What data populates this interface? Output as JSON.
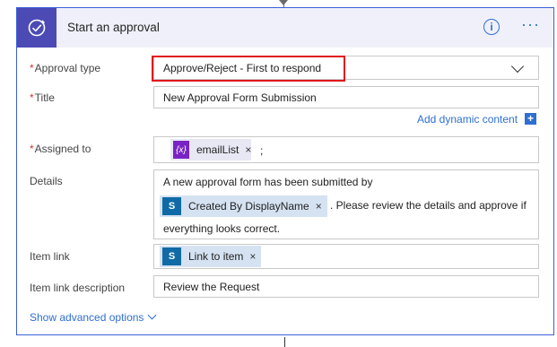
{
  "card": {
    "title": "Start an approval",
    "info_glyph": "i",
    "more_glyph": "···",
    "accent_color": "#4c4bb5",
    "border_color": "#3b60d9"
  },
  "fields": {
    "approval_type": {
      "label": "Approval type",
      "required_mark": "*",
      "value": "Approve/Reject - First to respond"
    },
    "title": {
      "label": "Title",
      "required_mark": "*",
      "value": "New Approval Form Submission"
    },
    "dynamic_content_label": "Add dynamic content",
    "dynamic_content_plus": "+",
    "assigned_to": {
      "label": "Assigned to",
      "required_mark": "*",
      "token_icon": "{x}",
      "token_label": "emailList",
      "token_remove": "×",
      "suffix": ";"
    },
    "details": {
      "label": "Details",
      "line1": "A new approval form has been submitted by",
      "token_icon": "S",
      "token_label": "Created By DisplayName",
      "token_remove": "×",
      "after_token": ". Please review the details and approve if",
      "line3": "everything looks correct."
    },
    "item_link": {
      "label": "Item link",
      "token_icon": "S",
      "token_label": "Link to item",
      "token_remove": "×"
    },
    "item_link_description": {
      "label": "Item link description",
      "value": "Review the Request"
    }
  },
  "advanced_options": "Show advanced options",
  "icons": {
    "app": "approval-icon",
    "info": "info-icon",
    "more": "more-options-icon",
    "dropdown": "chevron-down-icon",
    "variable": "variable-icon",
    "sharepoint": "sharepoint-icon"
  }
}
